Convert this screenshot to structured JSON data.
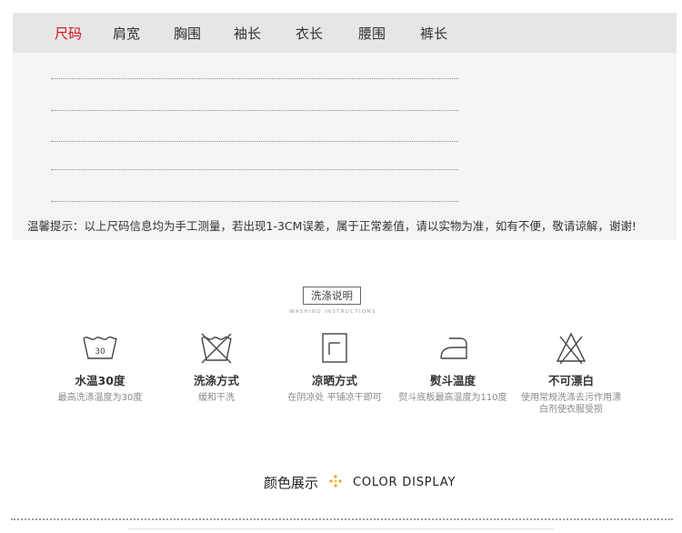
{
  "size_table": {
    "tabs": [
      "尺码",
      "肩宽",
      "胸围",
      "袖长",
      "衣长",
      "腰围",
      "裤长"
    ],
    "active_tab": "尺码",
    "accent_color": "#d9121b",
    "notice": "温馨提示：以上尺码信息均为手工测量，若出现1-3CM误差，属于正常差值，请以实物为准，如有不便，敬请谅解，谢谢!"
  },
  "washing": {
    "title": "洗涤说明",
    "subtitle": "WASHING INSTRUCTIONS",
    "items": [
      {
        "icon": "wash-tub-30-icon",
        "tub_number": "30",
        "label": "水温30度",
        "desc": "最高洗涤温度为30度"
      },
      {
        "icon": "do-not-wash-icon",
        "label": "洗涤方式",
        "desc": "缓和干洗"
      },
      {
        "icon": "drying-icon",
        "label": "凉晒方式",
        "desc": "在阴凉处 平铺凉干即可"
      },
      {
        "icon": "iron-icon",
        "label": "熨斗温度",
        "desc": "熨斗底板最高温度为110度"
      },
      {
        "icon": "do-not-bleach-icon",
        "label": "不可漂白",
        "desc": "使用常规洗涤去污作用漂白剂使衣服受损"
      }
    ]
  },
  "color_display": {
    "title_cn": "颜色展示",
    "title_en": "COLOR DISPLAY",
    "icon": "diamond-cluster-icon",
    "icon_color": "#e8a317"
  }
}
